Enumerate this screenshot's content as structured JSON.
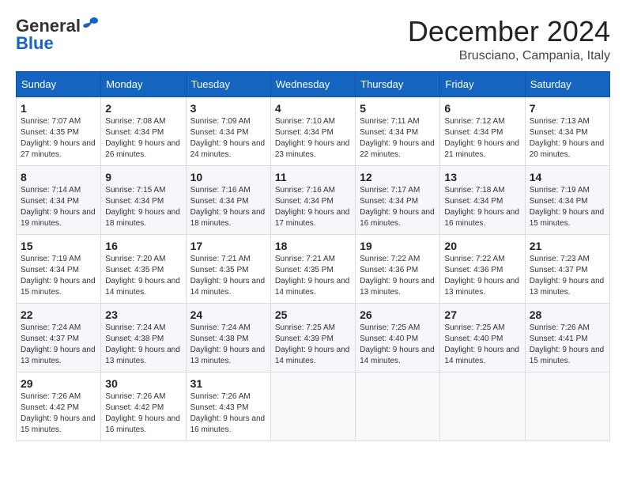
{
  "logo": {
    "line1": "General",
    "line2": "Blue"
  },
  "title": "December 2024",
  "location": "Brusciano, Campania, Italy",
  "days_of_week": [
    "Sunday",
    "Monday",
    "Tuesday",
    "Wednesday",
    "Thursday",
    "Friday",
    "Saturday"
  ],
  "weeks": [
    [
      {
        "day": "1",
        "sunrise": "Sunrise: 7:07 AM",
        "sunset": "Sunset: 4:35 PM",
        "daylight": "Daylight: 9 hours and 27 minutes."
      },
      {
        "day": "2",
        "sunrise": "Sunrise: 7:08 AM",
        "sunset": "Sunset: 4:34 PM",
        "daylight": "Daylight: 9 hours and 26 minutes."
      },
      {
        "day": "3",
        "sunrise": "Sunrise: 7:09 AM",
        "sunset": "Sunset: 4:34 PM",
        "daylight": "Daylight: 9 hours and 24 minutes."
      },
      {
        "day": "4",
        "sunrise": "Sunrise: 7:10 AM",
        "sunset": "Sunset: 4:34 PM",
        "daylight": "Daylight: 9 hours and 23 minutes."
      },
      {
        "day": "5",
        "sunrise": "Sunrise: 7:11 AM",
        "sunset": "Sunset: 4:34 PM",
        "daylight": "Daylight: 9 hours and 22 minutes."
      },
      {
        "day": "6",
        "sunrise": "Sunrise: 7:12 AM",
        "sunset": "Sunset: 4:34 PM",
        "daylight": "Daylight: 9 hours and 21 minutes."
      },
      {
        "day": "7",
        "sunrise": "Sunrise: 7:13 AM",
        "sunset": "Sunset: 4:34 PM",
        "daylight": "Daylight: 9 hours and 20 minutes."
      }
    ],
    [
      {
        "day": "8",
        "sunrise": "Sunrise: 7:14 AM",
        "sunset": "Sunset: 4:34 PM",
        "daylight": "Daylight: 9 hours and 19 minutes."
      },
      {
        "day": "9",
        "sunrise": "Sunrise: 7:15 AM",
        "sunset": "Sunset: 4:34 PM",
        "daylight": "Daylight: 9 hours and 18 minutes."
      },
      {
        "day": "10",
        "sunrise": "Sunrise: 7:16 AM",
        "sunset": "Sunset: 4:34 PM",
        "daylight": "Daylight: 9 hours and 18 minutes."
      },
      {
        "day": "11",
        "sunrise": "Sunrise: 7:16 AM",
        "sunset": "Sunset: 4:34 PM",
        "daylight": "Daylight: 9 hours and 17 minutes."
      },
      {
        "day": "12",
        "sunrise": "Sunrise: 7:17 AM",
        "sunset": "Sunset: 4:34 PM",
        "daylight": "Daylight: 9 hours and 16 minutes."
      },
      {
        "day": "13",
        "sunrise": "Sunrise: 7:18 AM",
        "sunset": "Sunset: 4:34 PM",
        "daylight": "Daylight: 9 hours and 16 minutes."
      },
      {
        "day": "14",
        "sunrise": "Sunrise: 7:19 AM",
        "sunset": "Sunset: 4:34 PM",
        "daylight": "Daylight: 9 hours and 15 minutes."
      }
    ],
    [
      {
        "day": "15",
        "sunrise": "Sunrise: 7:19 AM",
        "sunset": "Sunset: 4:34 PM",
        "daylight": "Daylight: 9 hours and 15 minutes."
      },
      {
        "day": "16",
        "sunrise": "Sunrise: 7:20 AM",
        "sunset": "Sunset: 4:35 PM",
        "daylight": "Daylight: 9 hours and 14 minutes."
      },
      {
        "day": "17",
        "sunrise": "Sunrise: 7:21 AM",
        "sunset": "Sunset: 4:35 PM",
        "daylight": "Daylight: 9 hours and 14 minutes."
      },
      {
        "day": "18",
        "sunrise": "Sunrise: 7:21 AM",
        "sunset": "Sunset: 4:35 PM",
        "daylight": "Daylight: 9 hours and 14 minutes."
      },
      {
        "day": "19",
        "sunrise": "Sunrise: 7:22 AM",
        "sunset": "Sunset: 4:36 PM",
        "daylight": "Daylight: 9 hours and 13 minutes."
      },
      {
        "day": "20",
        "sunrise": "Sunrise: 7:22 AM",
        "sunset": "Sunset: 4:36 PM",
        "daylight": "Daylight: 9 hours and 13 minutes."
      },
      {
        "day": "21",
        "sunrise": "Sunrise: 7:23 AM",
        "sunset": "Sunset: 4:37 PM",
        "daylight": "Daylight: 9 hours and 13 minutes."
      }
    ],
    [
      {
        "day": "22",
        "sunrise": "Sunrise: 7:24 AM",
        "sunset": "Sunset: 4:37 PM",
        "daylight": "Daylight: 9 hours and 13 minutes."
      },
      {
        "day": "23",
        "sunrise": "Sunrise: 7:24 AM",
        "sunset": "Sunset: 4:38 PM",
        "daylight": "Daylight: 9 hours and 13 minutes."
      },
      {
        "day": "24",
        "sunrise": "Sunrise: 7:24 AM",
        "sunset": "Sunset: 4:38 PM",
        "daylight": "Daylight: 9 hours and 13 minutes."
      },
      {
        "day": "25",
        "sunrise": "Sunrise: 7:25 AM",
        "sunset": "Sunset: 4:39 PM",
        "daylight": "Daylight: 9 hours and 14 minutes."
      },
      {
        "day": "26",
        "sunrise": "Sunrise: 7:25 AM",
        "sunset": "Sunset: 4:40 PM",
        "daylight": "Daylight: 9 hours and 14 minutes."
      },
      {
        "day": "27",
        "sunrise": "Sunrise: 7:25 AM",
        "sunset": "Sunset: 4:40 PM",
        "daylight": "Daylight: 9 hours and 14 minutes."
      },
      {
        "day": "28",
        "sunrise": "Sunrise: 7:26 AM",
        "sunset": "Sunset: 4:41 PM",
        "daylight": "Daylight: 9 hours and 15 minutes."
      }
    ],
    [
      {
        "day": "29",
        "sunrise": "Sunrise: 7:26 AM",
        "sunset": "Sunset: 4:42 PM",
        "daylight": "Daylight: 9 hours and 15 minutes."
      },
      {
        "day": "30",
        "sunrise": "Sunrise: 7:26 AM",
        "sunset": "Sunset: 4:42 PM",
        "daylight": "Daylight: 9 hours and 16 minutes."
      },
      {
        "day": "31",
        "sunrise": "Sunrise: 7:26 AM",
        "sunset": "Sunset: 4:43 PM",
        "daylight": "Daylight: 9 hours and 16 minutes."
      },
      null,
      null,
      null,
      null
    ]
  ]
}
